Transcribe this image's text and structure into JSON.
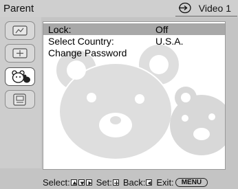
{
  "header": {
    "title": "Parent",
    "input_label": "Video 1",
    "input_icon": "input-arrow-icon"
  },
  "sidebar": {
    "items": [
      {
        "name": "picture-settings",
        "icon": "picture-icon",
        "active": false
      },
      {
        "name": "sound-settings",
        "icon": "sound-icon",
        "active": false
      },
      {
        "name": "parent-settings",
        "icon": "bear-icon",
        "active": true
      },
      {
        "name": "setup-settings",
        "icon": "setup-icon",
        "active": false
      }
    ]
  },
  "menu": {
    "rows": [
      {
        "label": "Lock:",
        "value": "Off",
        "selected": true
      },
      {
        "label": "Select Country:",
        "value": "U.S.A.",
        "selected": false
      },
      {
        "label": "Change Password",
        "value": "",
        "selected": false
      }
    ]
  },
  "footer": {
    "select_label": "Select:",
    "set_label": "Set:",
    "back_label": "Back:",
    "exit_label": "Exit:",
    "menu_key": "MENU"
  },
  "colors": {
    "selected_row": "#a8a8a8",
    "panel_bg": "#ffffff",
    "watermark": "#dcdcdc"
  }
}
